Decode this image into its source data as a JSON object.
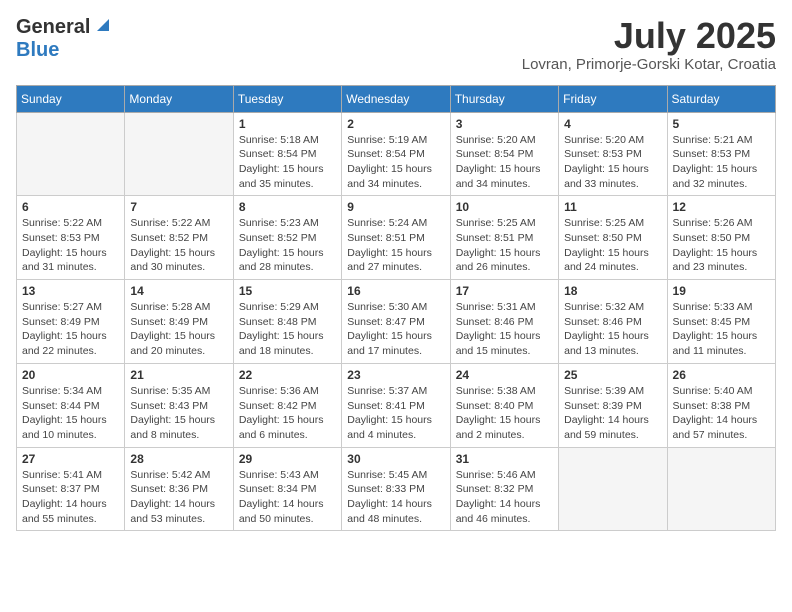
{
  "logo": {
    "general": "General",
    "blue": "Blue"
  },
  "title": "July 2025",
  "location": "Lovran, Primorje-Gorski Kotar, Croatia",
  "days_of_week": [
    "Sunday",
    "Monday",
    "Tuesday",
    "Wednesday",
    "Thursday",
    "Friday",
    "Saturday"
  ],
  "weeks": [
    [
      {
        "num": "",
        "info": ""
      },
      {
        "num": "",
        "info": ""
      },
      {
        "num": "1",
        "info": "Sunrise: 5:18 AM\nSunset: 8:54 PM\nDaylight: 15 hours and 35 minutes."
      },
      {
        "num": "2",
        "info": "Sunrise: 5:19 AM\nSunset: 8:54 PM\nDaylight: 15 hours and 34 minutes."
      },
      {
        "num": "3",
        "info": "Sunrise: 5:20 AM\nSunset: 8:54 PM\nDaylight: 15 hours and 34 minutes."
      },
      {
        "num": "4",
        "info": "Sunrise: 5:20 AM\nSunset: 8:53 PM\nDaylight: 15 hours and 33 minutes."
      },
      {
        "num": "5",
        "info": "Sunrise: 5:21 AM\nSunset: 8:53 PM\nDaylight: 15 hours and 32 minutes."
      }
    ],
    [
      {
        "num": "6",
        "info": "Sunrise: 5:22 AM\nSunset: 8:53 PM\nDaylight: 15 hours and 31 minutes."
      },
      {
        "num": "7",
        "info": "Sunrise: 5:22 AM\nSunset: 8:52 PM\nDaylight: 15 hours and 30 minutes."
      },
      {
        "num": "8",
        "info": "Sunrise: 5:23 AM\nSunset: 8:52 PM\nDaylight: 15 hours and 28 minutes."
      },
      {
        "num": "9",
        "info": "Sunrise: 5:24 AM\nSunset: 8:51 PM\nDaylight: 15 hours and 27 minutes."
      },
      {
        "num": "10",
        "info": "Sunrise: 5:25 AM\nSunset: 8:51 PM\nDaylight: 15 hours and 26 minutes."
      },
      {
        "num": "11",
        "info": "Sunrise: 5:25 AM\nSunset: 8:50 PM\nDaylight: 15 hours and 24 minutes."
      },
      {
        "num": "12",
        "info": "Sunrise: 5:26 AM\nSunset: 8:50 PM\nDaylight: 15 hours and 23 minutes."
      }
    ],
    [
      {
        "num": "13",
        "info": "Sunrise: 5:27 AM\nSunset: 8:49 PM\nDaylight: 15 hours and 22 minutes."
      },
      {
        "num": "14",
        "info": "Sunrise: 5:28 AM\nSunset: 8:49 PM\nDaylight: 15 hours and 20 minutes."
      },
      {
        "num": "15",
        "info": "Sunrise: 5:29 AM\nSunset: 8:48 PM\nDaylight: 15 hours and 18 minutes."
      },
      {
        "num": "16",
        "info": "Sunrise: 5:30 AM\nSunset: 8:47 PM\nDaylight: 15 hours and 17 minutes."
      },
      {
        "num": "17",
        "info": "Sunrise: 5:31 AM\nSunset: 8:46 PM\nDaylight: 15 hours and 15 minutes."
      },
      {
        "num": "18",
        "info": "Sunrise: 5:32 AM\nSunset: 8:46 PM\nDaylight: 15 hours and 13 minutes."
      },
      {
        "num": "19",
        "info": "Sunrise: 5:33 AM\nSunset: 8:45 PM\nDaylight: 15 hours and 11 minutes."
      }
    ],
    [
      {
        "num": "20",
        "info": "Sunrise: 5:34 AM\nSunset: 8:44 PM\nDaylight: 15 hours and 10 minutes."
      },
      {
        "num": "21",
        "info": "Sunrise: 5:35 AM\nSunset: 8:43 PM\nDaylight: 15 hours and 8 minutes."
      },
      {
        "num": "22",
        "info": "Sunrise: 5:36 AM\nSunset: 8:42 PM\nDaylight: 15 hours and 6 minutes."
      },
      {
        "num": "23",
        "info": "Sunrise: 5:37 AM\nSunset: 8:41 PM\nDaylight: 15 hours and 4 minutes."
      },
      {
        "num": "24",
        "info": "Sunrise: 5:38 AM\nSunset: 8:40 PM\nDaylight: 15 hours and 2 minutes."
      },
      {
        "num": "25",
        "info": "Sunrise: 5:39 AM\nSunset: 8:39 PM\nDaylight: 14 hours and 59 minutes."
      },
      {
        "num": "26",
        "info": "Sunrise: 5:40 AM\nSunset: 8:38 PM\nDaylight: 14 hours and 57 minutes."
      }
    ],
    [
      {
        "num": "27",
        "info": "Sunrise: 5:41 AM\nSunset: 8:37 PM\nDaylight: 14 hours and 55 minutes."
      },
      {
        "num": "28",
        "info": "Sunrise: 5:42 AM\nSunset: 8:36 PM\nDaylight: 14 hours and 53 minutes."
      },
      {
        "num": "29",
        "info": "Sunrise: 5:43 AM\nSunset: 8:34 PM\nDaylight: 14 hours and 50 minutes."
      },
      {
        "num": "30",
        "info": "Sunrise: 5:45 AM\nSunset: 8:33 PM\nDaylight: 14 hours and 48 minutes."
      },
      {
        "num": "31",
        "info": "Sunrise: 5:46 AM\nSunset: 8:32 PM\nDaylight: 14 hours and 46 minutes."
      },
      {
        "num": "",
        "info": ""
      },
      {
        "num": "",
        "info": ""
      }
    ]
  ]
}
